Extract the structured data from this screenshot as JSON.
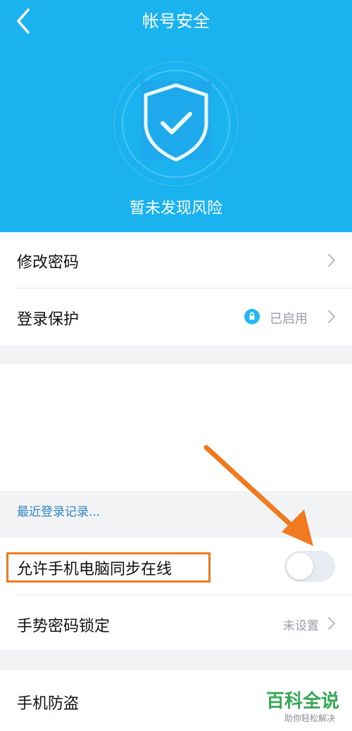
{
  "header": {
    "title": "帐号安全",
    "back_icon": "chevron-left-icon"
  },
  "hero": {
    "status_text": "暂未发现风险",
    "shield_icon": "shield-check-icon"
  },
  "settings": {
    "change_password": "修改密码",
    "login_protection": {
      "label": "登录保护",
      "status": "已启用",
      "icon": "lock-icon"
    }
  },
  "recent_login_link": "最近登录记录...",
  "sync_online": {
    "label": "允许手机电脑同步在线",
    "enabled": false
  },
  "gesture_lock": {
    "label": "手势密码锁定",
    "status": "未设置"
  },
  "anti_theft": {
    "label": "手机防盗"
  },
  "watermark": {
    "main": "百科全说",
    "sub": "助你轻松解决"
  },
  "colors": {
    "hero_bg": "#1ab3f0",
    "link": "#2f84c8",
    "highlight": "#f07a1f",
    "watermark": "#34a853"
  }
}
